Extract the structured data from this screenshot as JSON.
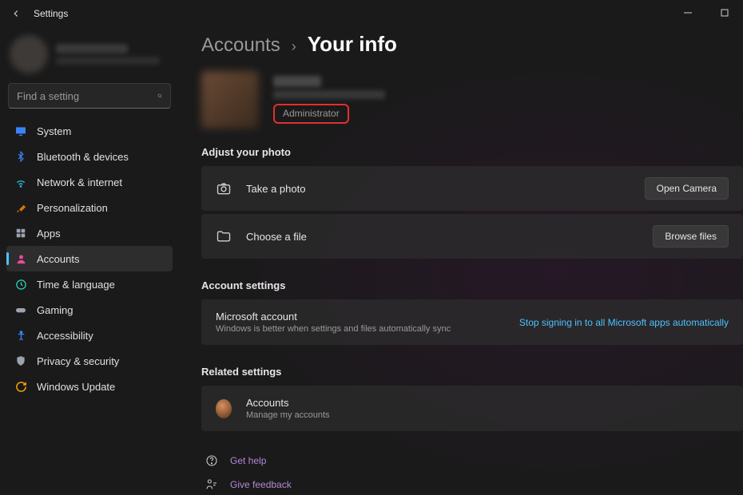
{
  "window": {
    "title": "Settings"
  },
  "search": {
    "placeholder": "Find a setting"
  },
  "nav": {
    "items": [
      {
        "label": "System"
      },
      {
        "label": "Bluetooth & devices"
      },
      {
        "label": "Network & internet"
      },
      {
        "label": "Personalization"
      },
      {
        "label": "Apps"
      },
      {
        "label": "Accounts"
      },
      {
        "label": "Time & language"
      },
      {
        "label": "Gaming"
      },
      {
        "label": "Accessibility"
      },
      {
        "label": "Privacy & security"
      },
      {
        "label": "Windows Update"
      }
    ]
  },
  "breadcrumb": {
    "parent": "Accounts",
    "current": "Your info"
  },
  "profile": {
    "role": "Administrator"
  },
  "sections": {
    "photo": {
      "heading": "Adjust your photo",
      "take": {
        "label": "Take a photo",
        "button": "Open Camera"
      },
      "choose": {
        "label": "Choose a file",
        "button": "Browse files"
      }
    },
    "account": {
      "heading": "Account settings",
      "ms": {
        "title": "Microsoft account",
        "sub": "Windows is better when settings and files automatically sync",
        "link": "Stop signing in to all Microsoft apps automatically"
      }
    },
    "related": {
      "heading": "Related settings",
      "accounts": {
        "title": "Accounts",
        "sub": "Manage my accounts"
      }
    }
  },
  "footer": {
    "help": "Get help",
    "feedback": "Give feedback"
  }
}
